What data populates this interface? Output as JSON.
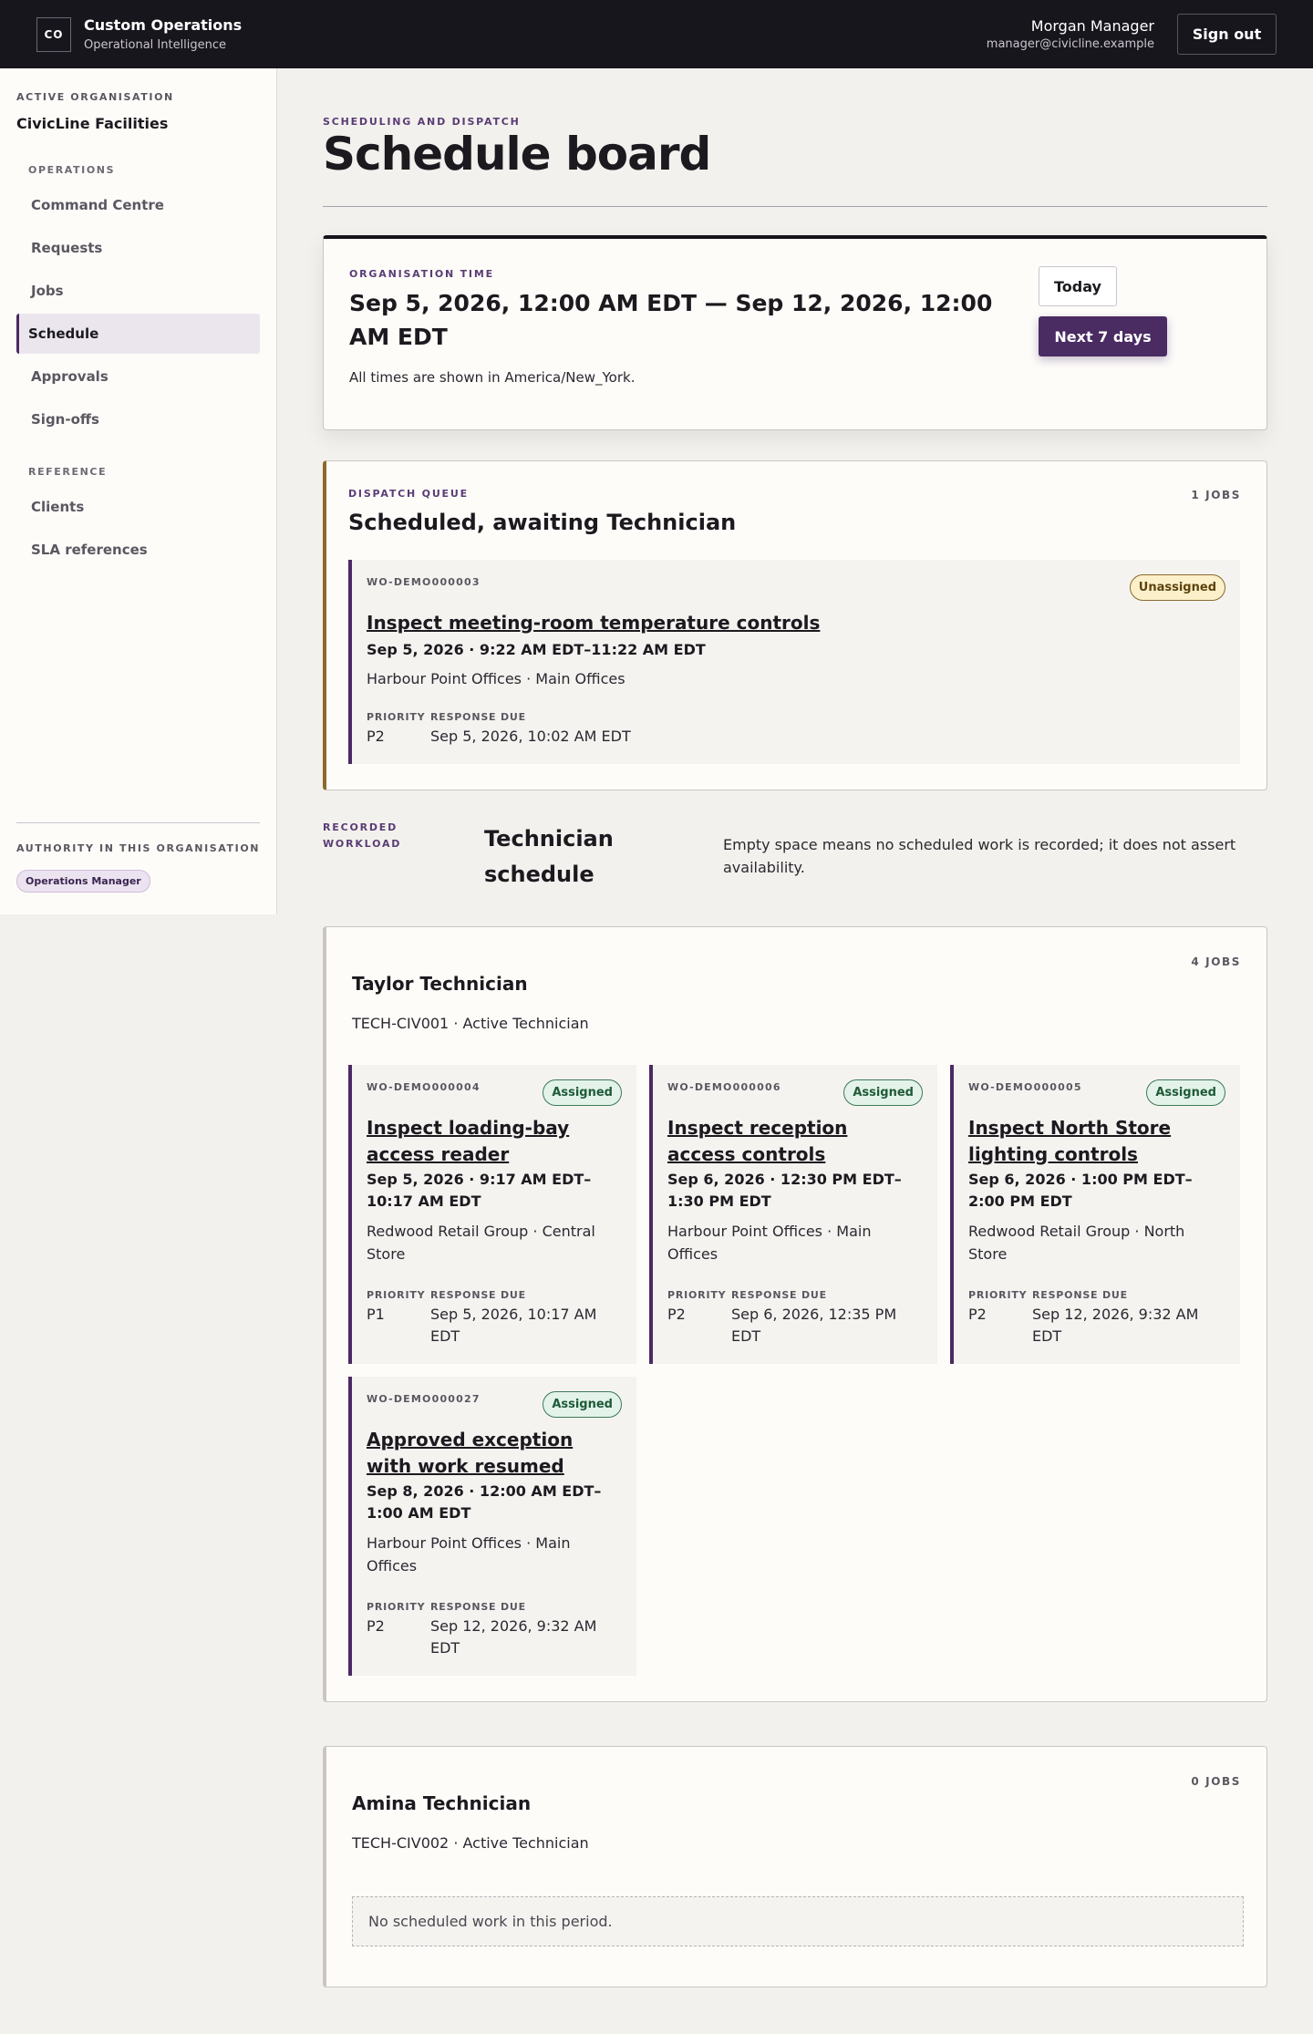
{
  "header": {
    "logo": "CO",
    "app_title": "Custom Operations",
    "app_subtitle": "Operational Intelligence",
    "user_name": "Morgan Manager",
    "user_email": "manager@civicline.example",
    "signout_label": "Sign out"
  },
  "sidebar": {
    "org_label": "ACTIVE ORGANISATION",
    "org_name": "CivicLine Facilities",
    "operations_label": "OPERATIONS",
    "operations": [
      "Command Centre",
      "Requests",
      "Jobs",
      "Schedule",
      "Approvals",
      "Sign-offs"
    ],
    "active_item": "Schedule",
    "reference_label": "REFERENCE",
    "reference": [
      "Clients",
      "SLA references"
    ],
    "authority_label": "AUTHORITY IN THIS ORGANISATION",
    "role": "Operations Manager"
  },
  "page": {
    "eyebrow": "SCHEDULING AND DISPATCH",
    "title": "Schedule board"
  },
  "time_window": {
    "eyebrow": "ORGANISATION TIME",
    "range": "Sep 5, 2026, 12:00 AM EDT — Sep 12, 2026, 12:00 AM EDT",
    "note": "All times are shown in America/New_York.",
    "today_label": "Today",
    "next_label": "Next 7 days"
  },
  "queue": {
    "eyebrow": "DISPATCH QUEUE",
    "title": "Scheduled, awaiting Technician",
    "count": "1 JOBS",
    "jobs": [
      {
        "id": "WO-DEMO000003",
        "status": "Unassigned",
        "title": "Inspect meeting-room temperature controls",
        "when": "Sep 5, 2026 · 9:22 AM EDT–11:22 AM EDT",
        "location": "Harbour Point Offices · Main Offices",
        "priority_label": "PRIORITY",
        "priority": "P2",
        "due_label": "RESPONSE DUE",
        "due": "Sep 5, 2026, 10:02 AM EDT"
      }
    ]
  },
  "workload": {
    "eyebrow": "RECORDED WORKLOAD",
    "title": "Technician schedule",
    "note": "Empty space means no scheduled work is recorded; it does not assert availability."
  },
  "technicians": [
    {
      "name": "Taylor Technician",
      "sub": "TECH-CIV001 · Active Technician",
      "count": "4 JOBS",
      "jobs": [
        {
          "id": "WO-DEMO000004",
          "status": "Assigned",
          "title": "Inspect loading-bay access reader",
          "when": "Sep 5, 2026 · 9:17 AM EDT–10:17 AM EDT",
          "location": "Redwood Retail Group · Central Store",
          "priority_label": "PRIORITY",
          "priority": "P1",
          "due_label": "RESPONSE DUE",
          "due": "Sep 5, 2026, 10:17 AM EDT"
        },
        {
          "id": "WO-DEMO000006",
          "status": "Assigned",
          "title": "Inspect reception access controls",
          "when": "Sep 6, 2026 · 12:30 PM EDT–1:30 PM EDT",
          "location": "Harbour Point Offices · Main Offices",
          "priority_label": "PRIORITY",
          "priority": "P2",
          "due_label": "RESPONSE DUE",
          "due": "Sep 6, 2026, 12:35 PM EDT"
        },
        {
          "id": "WO-DEMO000005",
          "status": "Assigned",
          "title": "Inspect North Store lighting controls",
          "when": "Sep 6, 2026 · 1:00 PM EDT–2:00 PM EDT",
          "location": "Redwood Retail Group · North Store",
          "priority_label": "PRIORITY",
          "priority": "P2",
          "due_label": "RESPONSE DUE",
          "due": "Sep 12, 2026, 9:32 AM EDT"
        },
        {
          "id": "WO-DEMO000027",
          "status": "Assigned",
          "title": "Approved exception with work resumed",
          "when": "Sep 8, 2026 · 12:00 AM EDT–1:00 AM EDT",
          "location": "Harbour Point Offices · Main Offices",
          "priority_label": "PRIORITY",
          "priority": "P2",
          "due_label": "RESPONSE DUE",
          "due": "Sep 12, 2026, 9:32 AM EDT"
        }
      ]
    },
    {
      "name": "Amina Technician",
      "sub": "TECH-CIV002 · Active Technician",
      "count": "0 JOBS",
      "empty": "No scheduled work in this period."
    }
  ]
}
